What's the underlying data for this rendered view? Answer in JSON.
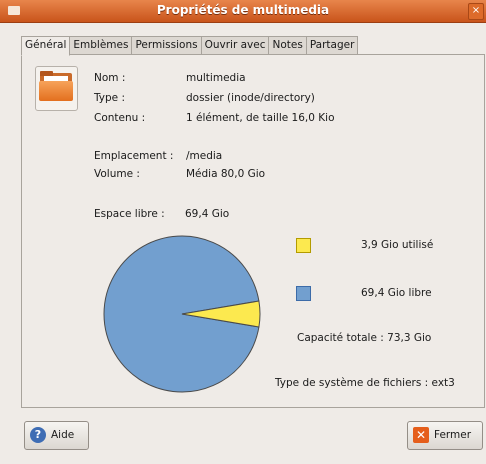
{
  "window": {
    "title": "Propriétés de multimedia",
    "close_glyph": "×"
  },
  "tabs": [
    "Général",
    "Emblèmes",
    "Permissions",
    "Ouvrir avec",
    "Notes",
    "Partager"
  ],
  "active_tab": "Général",
  "general": {
    "folder_icon": "folder-icon",
    "name_label": "Nom :",
    "name_value": "multimedia",
    "type_label": "Type :",
    "type_value": "dossier (inode/directory)",
    "contents_label": "Contenu :",
    "contents_value": "1 élément, de taille 16,0 Kio",
    "location_label": "Emplacement :",
    "location_value": "/media",
    "volume_label": "Volume :",
    "volume_value": "Média 80,0 Gio",
    "free_label": "Espace libre :",
    "free_value": "69,4 Gio"
  },
  "usage": {
    "used_legend": "3,9 Gio utilisé",
    "free_legend": "69,4 Gio libre",
    "total_capacity": "Capacité totale : 73,3 Gio",
    "fs_type": "Type de système de fichiers : ext3",
    "used_gio": 3.9,
    "free_gio": 69.4,
    "used_color": "#fce94f",
    "free_color": "#729fcf"
  },
  "buttons": {
    "help": "Aide",
    "close": "Fermer",
    "help_icon": "help-icon",
    "close_icon": "close-icon"
  }
}
